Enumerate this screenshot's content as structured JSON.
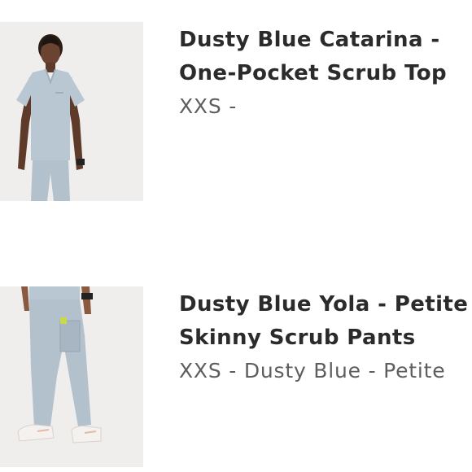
{
  "cart": {
    "items": [
      {
        "title_line_1": "Dusty Blue Catarina -",
        "title_line_2": "One-Pocket Scrub Top",
        "variant": "XXS -",
        "image_icon": "scrub-top-photo",
        "accent_color": "#b9c7d2"
      },
      {
        "title_line_1": "Dusty Blue Yola - Petite",
        "title_line_2": "Skinny Scrub Pants",
        "variant": "XXS - Dusty Blue - Petite",
        "image_icon": "scrub-pants-photo",
        "accent_color": "#b9c7d2"
      }
    ]
  }
}
